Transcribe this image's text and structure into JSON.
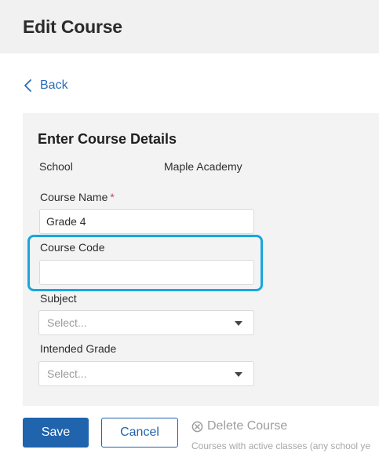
{
  "header": {
    "title": "Edit Course"
  },
  "nav": {
    "back_label": "Back"
  },
  "panel": {
    "title": "Enter Course Details",
    "school": {
      "label": "School",
      "value": "Maple Academy"
    },
    "course_name": {
      "label": "Course Name",
      "required_mark": "*",
      "value": "Grade 4"
    },
    "course_code": {
      "label": "Course Code",
      "value": ""
    },
    "subject": {
      "label": "Subject",
      "placeholder": "Select..."
    },
    "intended_grade": {
      "label": "Intended Grade",
      "placeholder": "Select..."
    }
  },
  "actions": {
    "save_label": "Save",
    "cancel_label": "Cancel",
    "delete_label": "Delete Course",
    "delete_note": "Courses with active classes (any school ye"
  },
  "colors": {
    "accent": "#1f64ad",
    "link": "#2a6cb6",
    "highlight": "#17a7de",
    "required": "#d0455a"
  }
}
